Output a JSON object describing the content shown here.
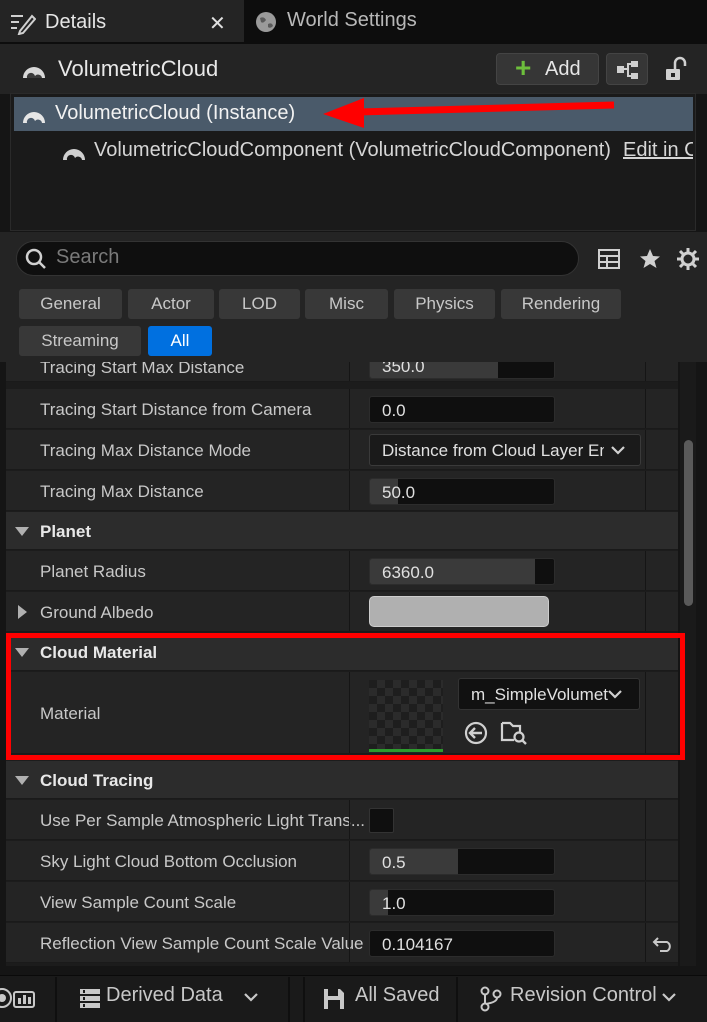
{
  "tabs": [
    {
      "label": "Details",
      "icon": "pencil-icon",
      "active": true
    },
    {
      "label": "World Settings",
      "icon": "globe-icon",
      "active": false
    }
  ],
  "header": {
    "actor_name": "VolumetricCloud",
    "add_label": "Add"
  },
  "components": {
    "instance_label": "VolumetricCloud (Instance)",
    "component_label": "VolumetricCloudComponent (VolumetricCloudComponent)",
    "edit_link": "Edit in C++"
  },
  "search": {
    "placeholder": "Search"
  },
  "filters": [
    "General",
    "Actor",
    "LOD",
    "Misc",
    "Physics",
    "Rendering",
    "Streaming",
    "All"
  ],
  "active_filter": "All",
  "properties": {
    "tracing_start_max": {
      "label": "Tracing Start Max Distance",
      "value": "350.0"
    },
    "tracing_start_cam": {
      "label": "Tracing Start Distance from Camera",
      "value": "0.0"
    },
    "tracing_max_mode": {
      "label": "Tracing Max Distance Mode",
      "value": "Distance from Cloud Layer Entr"
    },
    "tracing_max": {
      "label": "Tracing Max Distance",
      "value": "50.0"
    },
    "planet_cat": "Planet",
    "planet_radius": {
      "label": "Planet Radius",
      "value": "6360.0"
    },
    "ground_albedo": {
      "label": "Ground Albedo"
    },
    "cloud_material_cat": "Cloud Material",
    "material": {
      "label": "Material",
      "value": "m_SimpleVolumet"
    },
    "cloud_tracing_cat": "Cloud Tracing",
    "per_sample": {
      "label": "Use Per Sample Atmospheric Light Trans..."
    },
    "sky_light": {
      "label": "Sky Light Cloud Bottom Occlusion",
      "value": "0.5"
    },
    "view_sample": {
      "label": "View Sample Count Scale",
      "value": "1.0"
    },
    "reflection_view": {
      "label": "Reflection View Sample Count Scale Value",
      "value": "0.104167"
    }
  },
  "bottom_bar": {
    "derived_data": "Derived Data",
    "all_saved": "All Saved",
    "revision_control": "Revision Control"
  },
  "colors": {
    "highlight": "#ff0000",
    "selection": "#4a5a6a",
    "accent": "#0070e0",
    "add_plus": "#6dbf3c"
  }
}
